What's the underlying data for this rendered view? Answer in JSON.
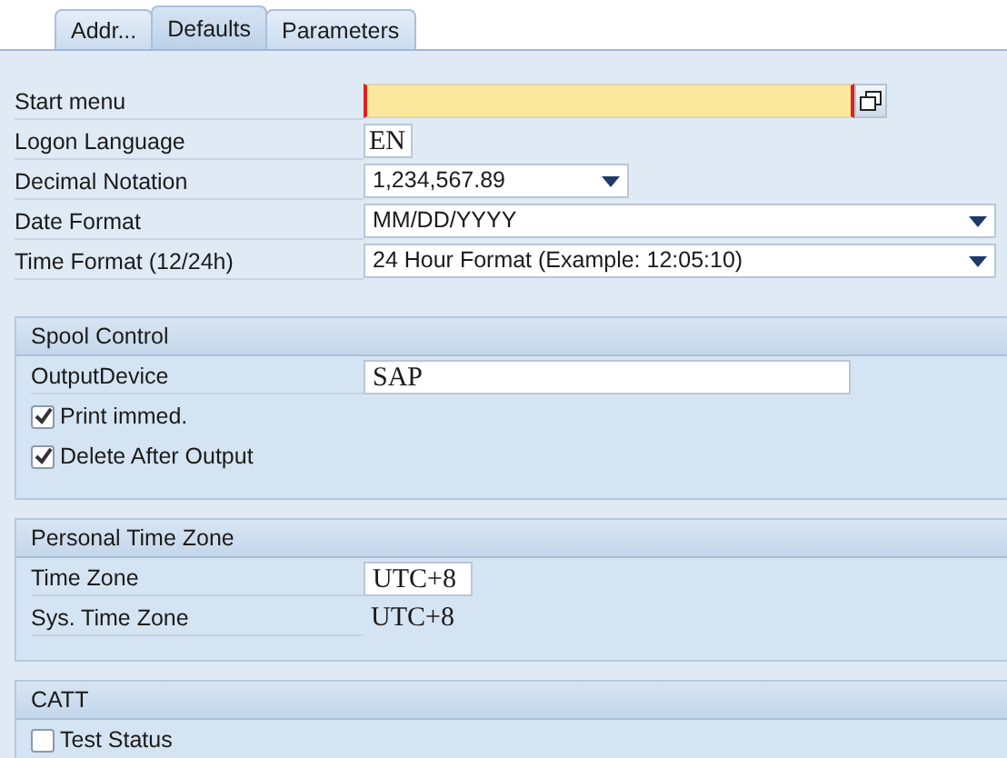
{
  "tabs": [
    {
      "label": "Addr...",
      "selected": false
    },
    {
      "label": "Defaults",
      "selected": true
    },
    {
      "label": "Parameters",
      "selected": false
    }
  ],
  "defaults": [
    {
      "kind": "help_input",
      "label": "Start menu",
      "required": true
    },
    {
      "kind": "short_input",
      "label": "Logon Language",
      "value": "EN"
    },
    {
      "kind": "dropdown",
      "label": "Decimal Notation",
      "value": "1,234,567.89"
    },
    {
      "kind": "wide_dropdown",
      "label": "Date Format",
      "value": "MM/DD/YYYY"
    },
    {
      "kind": "wide_dropdown",
      "label": "Time Format (12/24h)",
      "value": "24 Hour Format (Example: 12:05:10)"
    }
  ],
  "sections": [
    {
      "title": "Spool Control",
      "rows": [
        {
          "kind": "input",
          "label": "OutputDevice",
          "value": "SAP"
        },
        {
          "kind": "checkbox",
          "label": "Print immed.",
          "checked": true
        },
        {
          "kind": "checkbox",
          "label": "Delete After Output",
          "checked": true
        }
      ]
    },
    {
      "title": "Personal Time Zone",
      "rows": [
        {
          "kind": "short_input",
          "label": "Time Zone",
          "value": "UTC+8"
        },
        {
          "kind": "text",
          "label": "Sys. Time Zone",
          "value": "UTC+8"
        }
      ]
    },
    {
      "title": "CATT",
      "rows": [
        {
          "kind": "checkbox",
          "label": "Test Status",
          "checked": false
        }
      ]
    }
  ]
}
